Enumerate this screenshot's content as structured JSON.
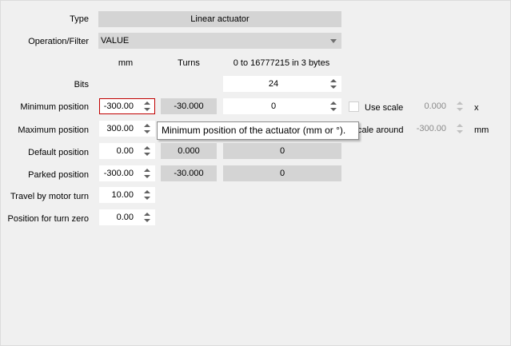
{
  "form": {
    "type_label": "Type",
    "type_value": "Linear actuator",
    "operation_label": "Operation/Filter",
    "operation_value": "VALUE",
    "col_mm": "mm",
    "col_turns": "Turns",
    "col_range": "0 to 16777215 in 3 bytes",
    "bits_label": "Bits",
    "bits_value": "24",
    "min_label": "Minimum position",
    "min_mm": "-300.00",
    "min_turns": "-30.000",
    "min_raw": "0",
    "max_label": "Maximum position",
    "max_mm": "300.00",
    "default_label": "Default position",
    "default_mm": "0.00",
    "default_turns": "0.000",
    "default_raw": "0",
    "parked_label": "Parked position",
    "parked_mm": "-300.00",
    "parked_turns": "-30.000",
    "parked_raw": "0",
    "travel_label": "Travel by motor turn",
    "travel_value": "10.00",
    "turnzero_label": "Position for turn zero",
    "turnzero_value": "0.00"
  },
  "scale": {
    "use_scale_label": "Use scale",
    "use_scale_value": "0.000",
    "use_scale_unit": "x",
    "scale_around_label": "cale around",
    "scale_around_value": "-300.00",
    "scale_around_unit": "mm"
  },
  "tooltip": {
    "text": "Minimum position of the actuator (mm or °)."
  }
}
